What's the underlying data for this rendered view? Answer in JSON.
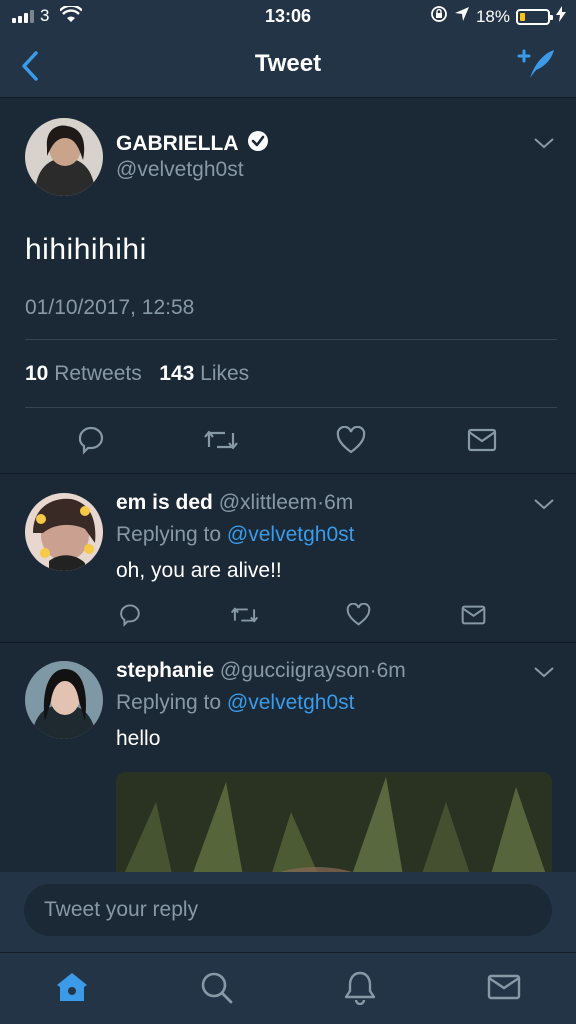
{
  "status_bar": {
    "carrier": "3",
    "time": "13:06",
    "battery_text": "18%",
    "battery_level": 0.18
  },
  "nav": {
    "title": "Tweet"
  },
  "main_tweet": {
    "name": "GABRIELLA",
    "handle": "@velvetgh0st",
    "text": "hihihihihi",
    "timestamp": "01/10/2017, 12:58",
    "retweets_count": "10",
    "retweets_label": "Retweets",
    "likes_count": "143",
    "likes_label": "Likes"
  },
  "replies": [
    {
      "name": "em is ded",
      "handle": "@xlittleem",
      "sep": "·",
      "time": "6m",
      "replying_prefix": "Replying to",
      "replying_to": "@velvetgh0st",
      "text": "oh, you are alive!!"
    },
    {
      "name": "stephanie",
      "handle": "@gucciigrayson",
      "sep": "·",
      "time": "6m",
      "replying_prefix": "Replying to",
      "replying_to": "@velvetgh0st",
      "text": "hello"
    }
  ],
  "reply_bar": {
    "placeholder": "Tweet your reply"
  },
  "colors": {
    "background": "#1b2836",
    "bar": "#243447",
    "accent": "#3b9be8",
    "muted": "#8899a6"
  },
  "icons": {
    "status": [
      "signal-icon",
      "wifi-icon",
      "orientation-lock-icon",
      "location-icon",
      "battery-icon",
      "charging-icon"
    ],
    "nav": [
      "back-chevron-icon",
      "compose-tweet-icon"
    ],
    "actions": [
      "reply-icon",
      "retweet-icon",
      "like-heart-icon",
      "direct-message-icon"
    ],
    "tabs": [
      "home-icon",
      "search-icon",
      "notifications-bell-icon",
      "messages-envelope-icon"
    ]
  }
}
